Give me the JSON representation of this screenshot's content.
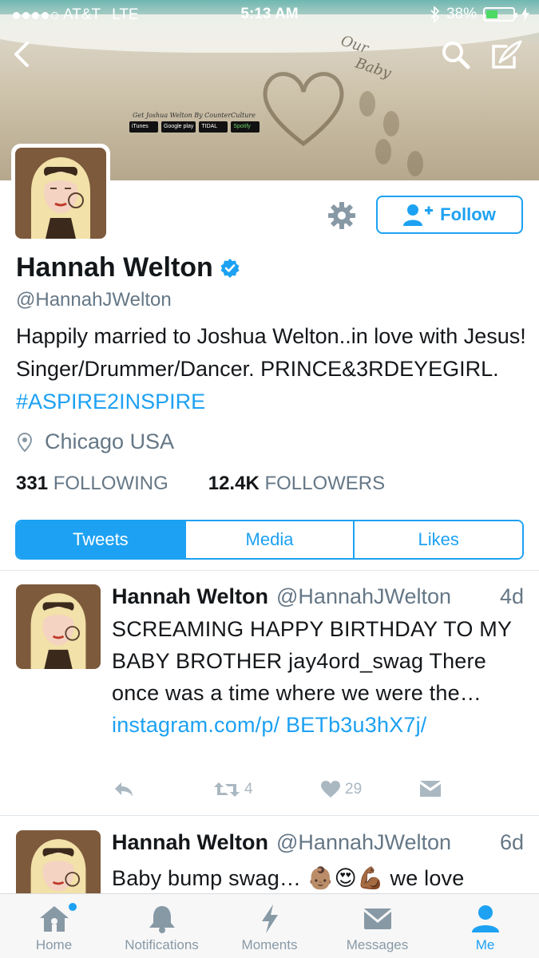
{
  "status_bar": {
    "carrier": "AT&T",
    "network": "LTE",
    "time": "5:13 AM",
    "battery": "38%"
  },
  "banner": {
    "sand_text_line1": "Our",
    "sand_text_line2": "Baby",
    "caption": "Get Joshua Welton By CounterCulture",
    "badges": [
      "iTunes",
      "Google play",
      "TIDAL",
      "Spotify"
    ]
  },
  "profile": {
    "name": "Hannah Welton",
    "handle": "@HannahJWelton",
    "bio_text": "Happily married to Joshua Welton..in love with Jesus! Singer/Drummer/Dancer. PRINCE&3RDEYEGIRL.",
    "bio_hashtag": "#ASPIRE2INSPIRE",
    "location": "Chicago USA",
    "following_count": "331",
    "following_label": "FOLLOWING",
    "followers_count": "12.4K",
    "followers_label": "FOLLOWERS",
    "follow_label": "Follow"
  },
  "tabs": [
    "Tweets",
    "Media",
    "Likes"
  ],
  "tweets": [
    {
      "name": "Hannah Welton",
      "handle": "@HannahJWelton",
      "time": "4d",
      "text": "SCREAMING HAPPY BIRTHDAY TO MY BABY BROTHER jay4ord_swag There once was a time where we were the…",
      "link": "instagram.com/p/ BETb3u3hX7j/",
      "retweets": "4",
      "likes": "29"
    },
    {
      "name": "Hannah Welton",
      "handle": "@HannahJWelton",
      "time": "6d",
      "text": "Baby bump swag… 👶🏽😍💪🏾 we love"
    }
  ],
  "bottom_nav": [
    "Home",
    "Notifications",
    "Moments",
    "Messages",
    "Me"
  ],
  "colors": {
    "accent": "#1da1f2",
    "muted": "#657786",
    "action_gray": "#aab8c2"
  }
}
